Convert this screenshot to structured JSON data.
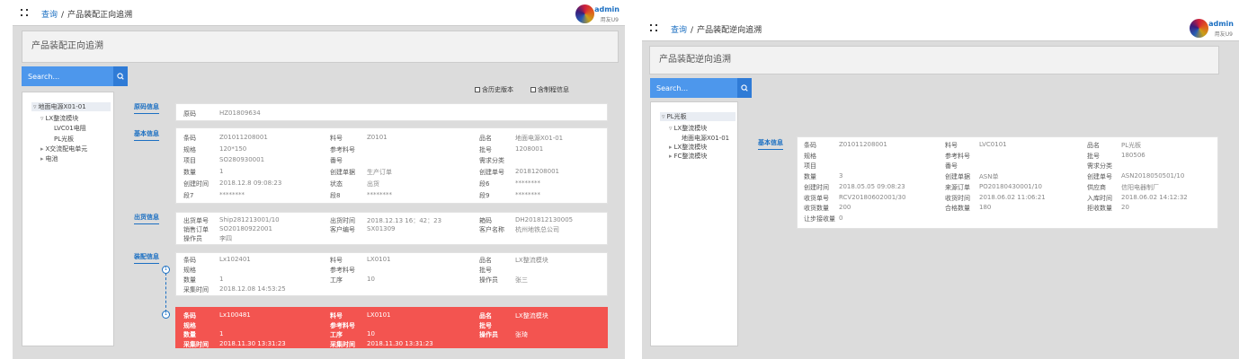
{
  "left": {
    "breadcrumb": {
      "home": "查询",
      "current": "产品装配正向追溯"
    },
    "user": {
      "name": "admin",
      "org": "用友U9"
    },
    "page_title": "产品装配正向追溯",
    "search": {
      "placeholder": "Search..."
    },
    "tree": [
      {
        "label": "地面电源X01-01",
        "caret": "▿"
      },
      {
        "label": "LX整流模块",
        "caret": "▿"
      },
      {
        "label": "LVC01电阻",
        "caret": ""
      },
      {
        "label": "PL光板",
        "caret": ""
      },
      {
        "label": "X交流配电单元",
        "caret": "▸"
      },
      {
        "label": "电池",
        "caret": "▸"
      }
    ],
    "options": [
      "含历史版本",
      "含制程信息"
    ],
    "sections": {
      "barcode": "原码信息",
      "basic": "基本信息",
      "shipping": "出货信息",
      "assembly": "装配信息"
    },
    "barcode_card": [
      [
        "原码",
        "HZ01809634"
      ]
    ],
    "basic_card": [
      [
        "条码",
        "Z01011208001",
        "料号",
        "Z0101",
        "品名",
        "地面电源X01-01"
      ],
      [
        "规格",
        "120*150",
        "参考料号",
        "",
        "批号",
        "1208001"
      ],
      [
        "项目",
        "SO280930001",
        "番号",
        "",
        "需求分类",
        ""
      ],
      [
        "数量",
        "1",
        "创建单据",
        "生产订单",
        "创建单号",
        "20181208001"
      ],
      [
        "创建时间",
        "2018.12.8  09:08:23",
        "状态",
        "出货",
        "段6",
        "********"
      ],
      [
        "段7",
        "********",
        "段8",
        "********",
        "段9",
        "********"
      ]
    ],
    "shipping_card": [
      [
        "出货单号",
        "Ship281213001/10",
        "出货时间",
        "2018.12.13 16：42：23",
        "箱码",
        "DH201812130005"
      ],
      [
        "销售订单",
        "SO20180922001",
        "客户编号",
        "SX01309",
        "客户名称",
        "杭州地铁总公司"
      ],
      [
        "操作员",
        "李四",
        "",
        "",
        "",
        ""
      ]
    ],
    "assembly_nodes": [
      "1",
      "1"
    ],
    "assembly_cards": [
      [
        [
          "条码",
          "Lx102401",
          "料号",
          "LX0101",
          "品名",
          "LX整流模块"
        ],
        [
          "规格",
          "",
          "参考料号",
          "",
          "批号",
          ""
        ],
        [
          "数量",
          "1",
          "工序",
          "10",
          "操作员",
          "张三"
        ],
        [
          "采集时间",
          "2018.12.08 14:53:25",
          "",
          "",
          "",
          ""
        ]
      ],
      [
        [
          "条码",
          "Lx100481",
          "料号",
          "LX0101",
          "品名",
          "LX整流模块"
        ],
        [
          "规格",
          "",
          "参考料号",
          "",
          "批号",
          ""
        ],
        [
          "数量",
          "1",
          "工序",
          "10",
          "操作员",
          "张琦"
        ],
        [
          "采集时间",
          "2018.11.30 13:31:23",
          "采集时间",
          "2018.11.30 13:31:23",
          "",
          ""
        ]
      ]
    ],
    "highlight_color": "#f35450"
  },
  "right": {
    "breadcrumb": {
      "home": "查询",
      "current": "产品装配逆向追溯"
    },
    "user": {
      "name": "admin",
      "org": "用友U9"
    },
    "page_title": "产品装配逆向追溯",
    "search": {
      "placeholder": "Search..."
    },
    "tree": [
      {
        "label": "PL光板",
        "caret": "▿"
      },
      {
        "label": "LX整流模块",
        "caret": "▿"
      },
      {
        "label": "地面电源X01-01",
        "caret": ""
      },
      {
        "label": "LX整流模块",
        "caret": "▸"
      },
      {
        "label": "FC整流模块",
        "caret": "▸"
      }
    ],
    "sections": {
      "basic": "基本信息"
    },
    "basic_card": [
      [
        "条码",
        "Z01011208001",
        "料号",
        "LVC0101",
        "品名",
        "PL光板"
      ],
      [
        "规格",
        "",
        "参考料号",
        "",
        "批号",
        "180506"
      ],
      [
        "项目",
        "",
        "番号",
        "",
        "需求分类",
        ""
      ],
      [
        "数量",
        "3",
        "创建单据",
        "ASN单",
        "创建单号",
        "ASN2018050501/10"
      ],
      [
        "创建时间",
        "2018.05.05  09:08:23",
        "来源订单",
        "PO20180430001/10",
        "供应商",
        "信阳电器制厂"
      ],
      [
        "收货单号",
        "RCV20180602001/30",
        "收货时间",
        "2018.06.02  11:06:21",
        "入库时间",
        "2018.06.02 14:12:32"
      ],
      [
        "收货数量",
        "200",
        "合格数量",
        "180",
        "拒收数量",
        "20"
      ],
      [
        "让步接收量",
        "0",
        "",
        "",
        "",
        ""
      ]
    ]
  }
}
